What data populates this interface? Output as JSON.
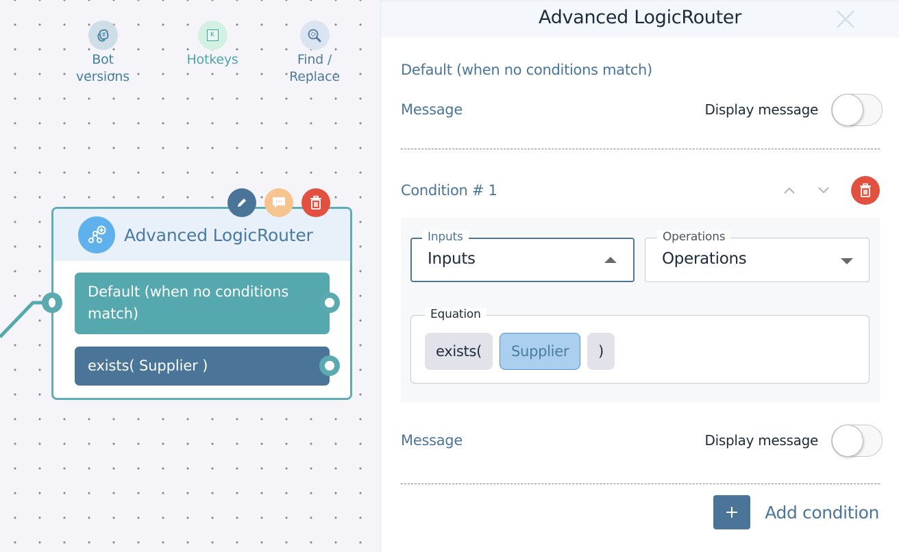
{
  "canvas": {
    "toolbar": [
      {
        "id": "bot-versions",
        "label_line1": "Bot",
        "label_line2": "versions",
        "icon": "bot-versions-icon"
      },
      {
        "id": "hotkeys",
        "label_line1": "Hotkeys",
        "icon": "hotkeys-icon",
        "icon_text": "K"
      },
      {
        "id": "find-replace",
        "label_line1": "Find /",
        "label_line2": "Replace",
        "icon": "find-replace-icon"
      }
    ],
    "node": {
      "title": "Advanced LogicRouter",
      "icon": "logic-router-icon",
      "actions": [
        "edit-icon",
        "message-icon",
        "trash-icon"
      ],
      "branches": [
        {
          "label": "Default (when no conditions match)",
          "color": "#55a9ae"
        },
        {
          "label": "exists( Supplier )",
          "color": "#4a7599"
        }
      ]
    }
  },
  "panel": {
    "title": "Advanced LogicRouter",
    "close_icon": "close-icon",
    "default_section": {
      "title": "Default (when no conditions match)",
      "message_label": "Message",
      "display_label": "Display message",
      "display_enabled": false
    },
    "conditions": [
      {
        "title": "Condition # 1",
        "inputs": {
          "legend": "Inputs",
          "value": "Inputs",
          "open": true
        },
        "operations": {
          "legend": "Operations",
          "value": "Operations",
          "open": false
        },
        "equation": {
          "legend": "Equation",
          "tokens": [
            {
              "text": "exists(",
              "kind": "function"
            },
            {
              "text": "Supplier",
              "kind": "field"
            },
            {
              "text": ")",
              "kind": "paren"
            }
          ]
        },
        "message_label": "Message",
        "display_label": "Display message",
        "display_enabled": false
      }
    ],
    "add_condition_label": "Add condition",
    "add_icon_text": "+"
  },
  "colors": {
    "accent": "#4a7599",
    "teal": "#55a9ae",
    "danger": "#e2503f",
    "node_icon": "#5eb1ea",
    "message_action": "#f6c48e"
  }
}
